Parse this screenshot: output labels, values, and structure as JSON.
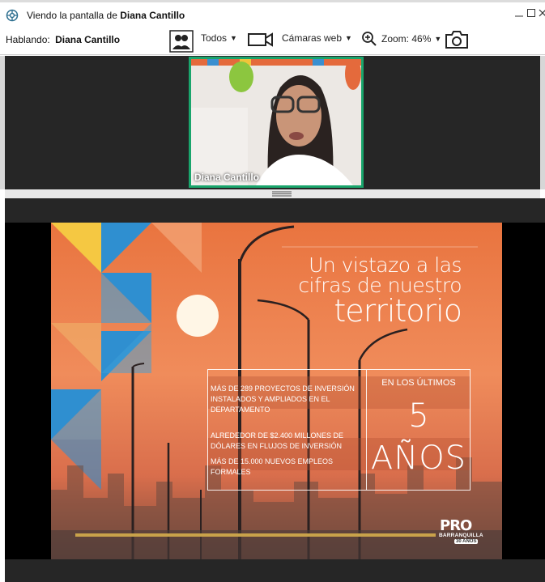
{
  "window": {
    "title_prefix": "Viendo la pantalla de",
    "title_name": "Diana Cantillo"
  },
  "toolbar": {
    "speaking_label": "Hablando:",
    "speaking_name": "Diana Cantillo",
    "filter_label": "Todos",
    "cameras_label": "Cámaras web",
    "zoom_label": "Zoom: 46%"
  },
  "video": {
    "participant_name": "Diana Cantillo"
  },
  "slide": {
    "title_line1": "Un vistazo a las",
    "title_line2": "cifras de nuestro",
    "title_line3": "territorio",
    "stat1": "MÁS DE 289 PROYECTOS DE INVERSIÓN INSTALADOS Y AMPLIADOS EN EL DEPARTAMENTO",
    "stat2": "ALREDEDOR DE $2.400 MILLONES DE DÓLARES EN FLUJOS DE INVERSIÓN",
    "stat3": "MÁS DE 15.000 NUEVOS EMPLEOS FORMALES",
    "period_label": "EN LOS ÚLTIMOS",
    "period_number": "5",
    "period_unit": "AÑOS",
    "logo_main": "PRO",
    "logo_sub": "BARRANQUILLA",
    "logo_years": "30 AÑOS"
  }
}
